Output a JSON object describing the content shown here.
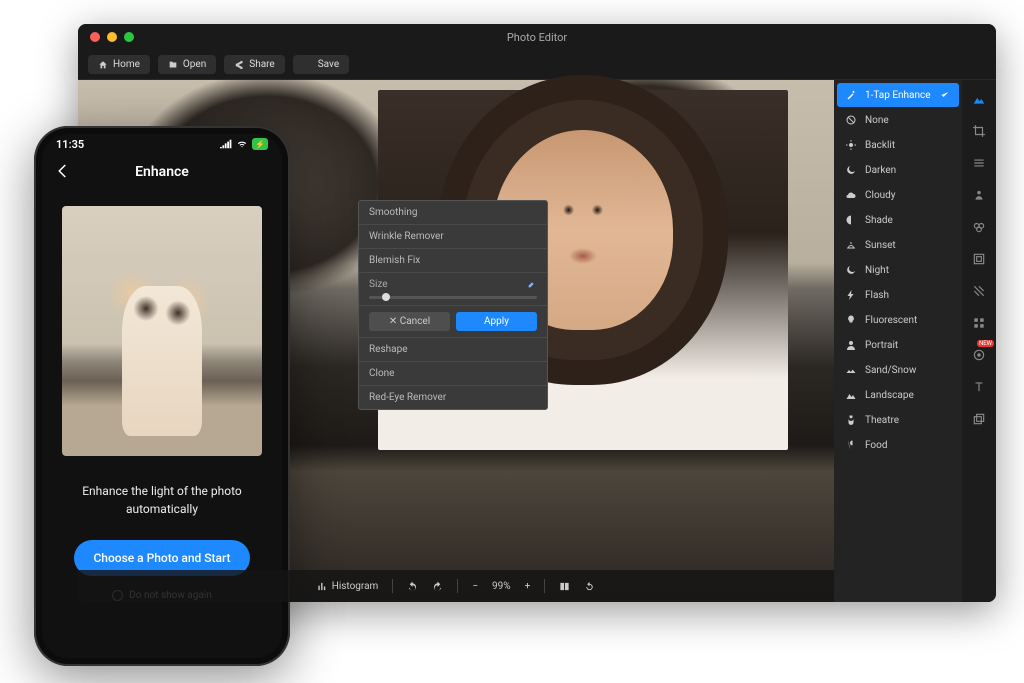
{
  "window": {
    "title": "Photo Editor",
    "toolbar": {
      "home": "Home",
      "open": "Open",
      "share": "Share",
      "save": "Save"
    }
  },
  "retouch_panel": {
    "smoothing": "Smoothing",
    "wrinkle": "Wrinkle Remover",
    "blemish": "Blemish Fix",
    "size_label": "Size",
    "cancel": "Cancel",
    "apply": "Apply",
    "reshape": "Reshape",
    "clone": "Clone",
    "redeye": "Red-Eye Remover"
  },
  "bottombar": {
    "histogram": "Histogram",
    "zoom": "99%"
  },
  "enhance": {
    "items": [
      {
        "label": "1-Tap Enhance",
        "icon": "wand"
      },
      {
        "label": "None",
        "icon": "none"
      },
      {
        "label": "Backlit",
        "icon": "backlit"
      },
      {
        "label": "Darken",
        "icon": "moon"
      },
      {
        "label": "Cloudy",
        "icon": "cloud"
      },
      {
        "label": "Shade",
        "icon": "shade"
      },
      {
        "label": "Sunset",
        "icon": "sunset"
      },
      {
        "label": "Night",
        "icon": "night"
      },
      {
        "label": "Flash",
        "icon": "flash"
      },
      {
        "label": "Fluorescent",
        "icon": "bulb"
      },
      {
        "label": "Portrait",
        "icon": "portrait"
      },
      {
        "label": "Sand/Snow",
        "icon": "sand"
      },
      {
        "label": "Landscape",
        "icon": "landscape"
      },
      {
        "label": "Theatre",
        "icon": "theatre"
      },
      {
        "label": "Food",
        "icon": "food"
      }
    ]
  },
  "right_tools": {
    "badge": "NEW"
  },
  "phone": {
    "status_time": "11:35",
    "header_title": "Enhance",
    "desc_line1": "Enhance the light of the photo",
    "desc_line2": "automatically",
    "cta": "Choose a Photo and Start",
    "skip": "Do not show again"
  }
}
